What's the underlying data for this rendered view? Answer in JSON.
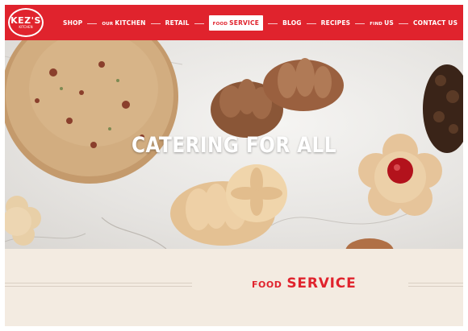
{
  "brand": {
    "name": "KEZ'S",
    "tagline": "KITCHEN"
  },
  "nav": {
    "items": [
      {
        "label": "SHOP",
        "small": ""
      },
      {
        "label": "KITCHEN",
        "small": "OUR"
      },
      {
        "label": "RETAIL",
        "small": ""
      },
      {
        "label": "SERVICE",
        "small": "FOOD",
        "active": true
      },
      {
        "label": "BLOG",
        "small": ""
      },
      {
        "label": "RECIPES",
        "small": ""
      },
      {
        "label": "US",
        "small": "FIND"
      },
      {
        "label": "CONTACT US",
        "small": ""
      }
    ]
  },
  "hero": {
    "title": "CATERING FOR ALL"
  },
  "section": {
    "title_small": "FOOD",
    "title_main": "SERVICE"
  },
  "colors": {
    "brand_red": "#e0232d",
    "section_bg": "#f3ebe1"
  }
}
